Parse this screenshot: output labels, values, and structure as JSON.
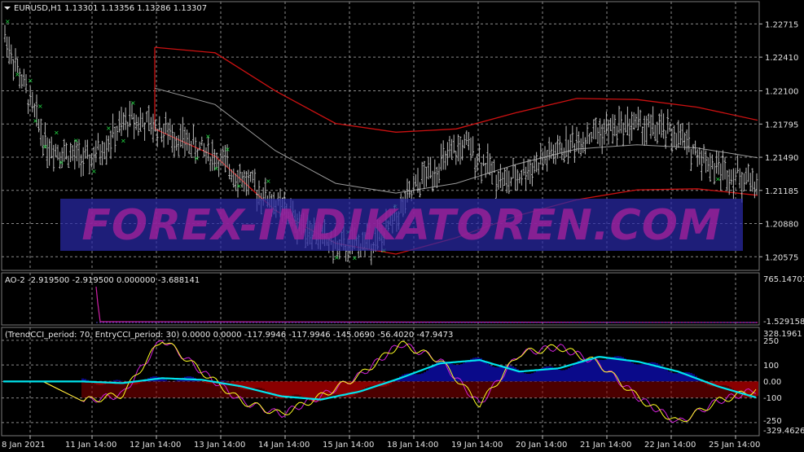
{
  "colors": {
    "background": "#000000",
    "grid": "#8a8a8a",
    "bullish_bar": "#bcbcbc",
    "channel": "#cc1111",
    "midline": "#9a9a9a",
    "arrow_marks": "#22dd44",
    "ao_line": "#d020a8",
    "cci_trend": "#00e5ee",
    "cci_fill_pos": "#0a0a8a",
    "cci_fill_neg": "#8b0000",
    "cci_entry": "#ffff22",
    "cci_magenta": "#d020d8",
    "watermark_text": "#a0209a",
    "watermark_box": "#2a2aa8"
  },
  "main_chart": {
    "header": "EURUSD,H1  1.13301 1.13356 1.13286 1.13307",
    "price_ticks": [
      "1.22715",
      "1.22410",
      "1.22100",
      "1.21795",
      "1.21490",
      "1.21185",
      "1.20880",
      "1.20575"
    ]
  },
  "ao_panel": {
    "header": "AO-2 -2.919500 -2.919500 0.000000 -3.688141",
    "top_value": "765.14701",
    "bottom_value": "-1.529158"
  },
  "cci_panel": {
    "header": "(TrendCCI_period: 70, EntryCCI_period: 30)  0.0000 0.0000 -117.9946 -117.9946 -145.0690 -56.4020 -47.9473",
    "top_value": "328.1961",
    "levels": [
      "250",
      "100",
      "0.00",
      "-100",
      "-250"
    ],
    "bottom_value": "-329.4626"
  },
  "time_axis": [
    "8 Jan 2021",
    "11 Jan 14:00",
    "12 Jan 14:00",
    "13 Jan 14:00",
    "14 Jan 14:00",
    "15 Jan 14:00",
    "18 Jan 14:00",
    "19 Jan 14:00",
    "20 Jan 14:00",
    "21 Jan 14:00",
    "22 Jan 14:00",
    "25 Jan 14:00"
  ],
  "watermark": "FOREX-INDIKATOREN.COM",
  "chart_data": {
    "type": "line",
    "symbol": "EURUSD,H1",
    "ohlc_last": {
      "open": 1.13301,
      "high": 1.13356,
      "low": 1.13286,
      "close": 1.13307
    },
    "price_ylim": [
      1.2045,
      1.2292
    ],
    "x": [
      "8 Jan",
      "11 Jan",
      "12 Jan",
      "13 Jan",
      "14 Jan",
      "15 Jan",
      "18 Jan",
      "19 Jan",
      "20 Jan",
      "21 Jan",
      "22 Jan",
      "25 Jan"
    ],
    "price_path": [
      1.226,
      1.216,
      1.2145,
      1.2185,
      1.217,
      1.215,
      1.212,
      1.209,
      1.2065,
      1.2075,
      1.213,
      1.216,
      1.2125,
      1.215,
      1.217,
      1.218,
      1.217,
      1.214,
      1.2125
    ],
    "channel_upper": [
      1.225,
      1.2245,
      1.221,
      1.218,
      1.2172,
      1.2175,
      1.219,
      1.2203,
      1.2202,
      1.2195,
      1.2183
    ],
    "channel_lower": [
      1.2175,
      1.215,
      1.21,
      1.207,
      1.206,
      1.2075,
      1.2095,
      1.211,
      1.2119,
      1.212,
      1.2114
    ],
    "cci_levels": [
      250,
      100,
      0,
      -100,
      -250
    ],
    "cci_ylim": [
      -329.4626,
      328.1961
    ],
    "cci_trend": [
      0,
      0,
      0,
      -10,
      20,
      10,
      -30,
      -90,
      -110,
      -60,
      20,
      110,
      130,
      60,
      80,
      150,
      120,
      60,
      -30,
      -100
    ],
    "cci_entry": [
      0,
      0,
      -120,
      -80,
      260,
      60,
      -120,
      -200,
      -90,
      40,
      230,
      130,
      -140,
      170,
      210,
      110,
      -100,
      -250,
      -120,
      -48
    ]
  }
}
